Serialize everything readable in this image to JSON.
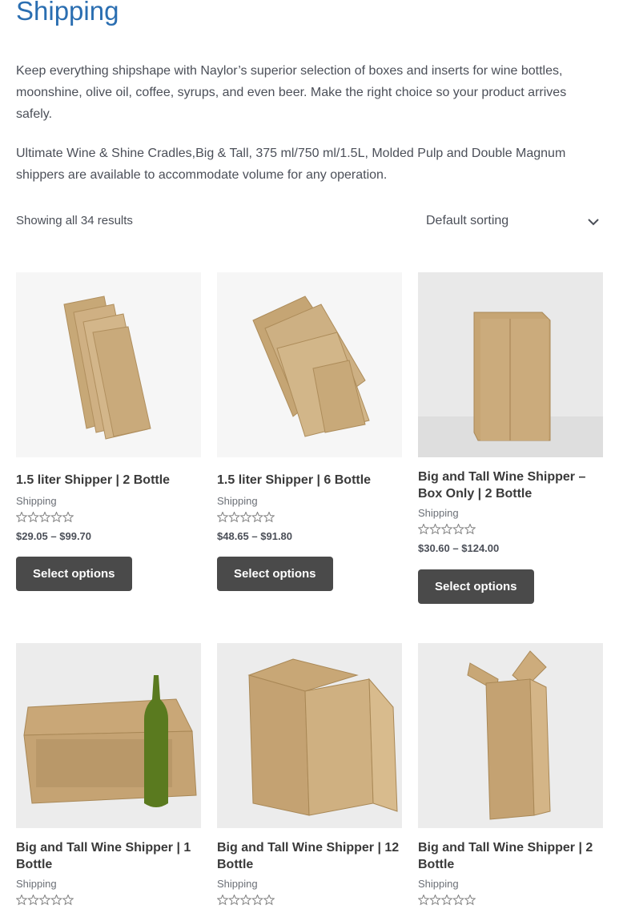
{
  "page": {
    "title": "Shipping",
    "description_1": "Keep everything shipshape with Naylor’s superior selection of boxes and inserts for wine bottles, moonshine, olive oil, coffee, syrups, and even beer. Make the right choice so your product arrives safely.",
    "description_2": "Ultimate Wine & Shine Cradles,Big & Tall, 375 ml/750 ml/1.5L, Molded Pulp and Double Magnum shippers are available to accommodate volume for any operation."
  },
  "toolbar": {
    "result_count": "Showing all 34 results",
    "sort_selected": "Default sorting",
    "sort_icon": "chevron-down-icon"
  },
  "products": [
    {
      "title": "1.5 liter Shipper | 2 Bottle",
      "category": "Shipping",
      "rating": 0,
      "price_low": "$29.05",
      "price_sep": "–",
      "price_high": "$99.70",
      "button": "Select options"
    },
    {
      "title": "1.5 liter Shipper | 6 Bottle",
      "category": "Shipping",
      "rating": 0,
      "price_low": "$48.65",
      "price_sep": "–",
      "price_high": "$91.80",
      "button": "Select options"
    },
    {
      "title": "Big and Tall Wine Shipper – Box Only | 2 Bottle",
      "category": "Shipping",
      "rating": 0,
      "price_low": "$30.60",
      "price_sep": "–",
      "price_high": "$124.00",
      "button": "Select options"
    },
    {
      "title": "Big and Tall Wine Shipper | 1 Bottle",
      "category": "Shipping",
      "rating": 0
    },
    {
      "title": "Big and Tall Wine Shipper | 12 Bottle",
      "category": "Shipping",
      "rating": 0
    },
    {
      "title": "Big and Tall Wine Shipper | 2 Bottle",
      "category": "Shipping",
      "rating": 0
    }
  ],
  "colors": {
    "title": "#2a6eb1",
    "button_bg": "#4a4a4a",
    "button_text": "#ffffff",
    "box_kraft": "#c9a979",
    "star_outline": "#808080"
  }
}
